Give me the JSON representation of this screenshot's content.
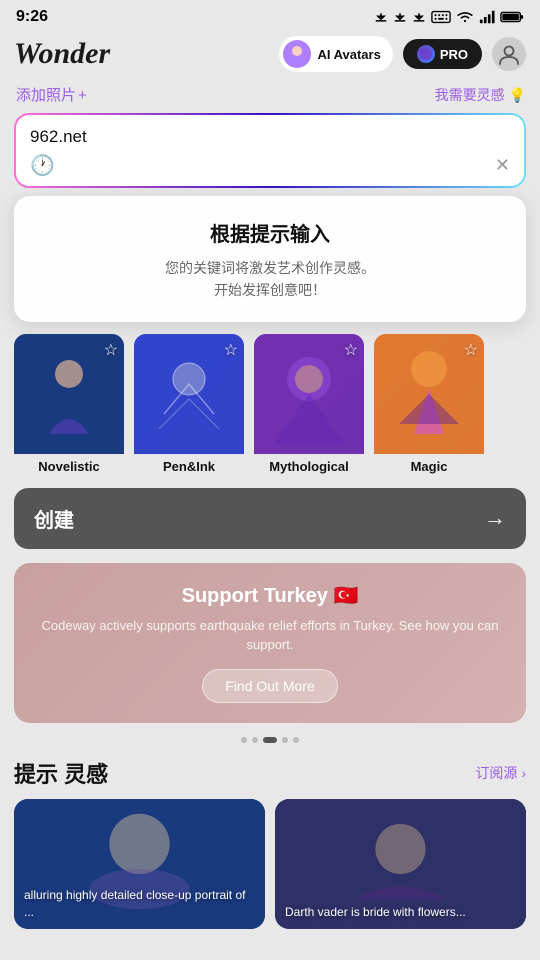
{
  "statusBar": {
    "time": "9:26"
  },
  "header": {
    "logo": "Wonder",
    "aiAvatarsLabel": "AI Avatars",
    "proLabel": "PRO"
  },
  "subtitle": {
    "addPhoto": "添加照片",
    "addPhotoIcon": "+",
    "needInspiration": "我需要灵感 💡"
  },
  "searchInput": {
    "value": "962.net",
    "placeholder": ""
  },
  "tooltipPopup": {
    "title": "根据提示输入",
    "description": "您的关键词将激发艺术创作灵感。\n开始发挥创意吧！"
  },
  "styleCards": [
    {
      "id": "novelistic",
      "label": "Novelistic",
      "cardClass": "card-novelistic"
    },
    {
      "id": "penink",
      "label": "Pen&Ink",
      "cardClass": "card-penink"
    },
    {
      "id": "mythological",
      "label": "Mythological",
      "cardClass": "card-mythological"
    },
    {
      "id": "magic",
      "label": "Magic",
      "cardClass": "card-magic"
    }
  ],
  "createButton": {
    "label": "创建",
    "arrow": "→"
  },
  "supportBanner": {
    "title": "Support Turkey 🇹🇷",
    "description": "Codeway actively supports earthquake relief efforts in Turkey. See how you can support.",
    "buttonLabel": "Find Out More"
  },
  "dots": [
    {
      "active": false
    },
    {
      "active": false
    },
    {
      "active": true
    },
    {
      "active": false
    },
    {
      "active": false
    }
  ],
  "inspirationSection": {
    "title": "提示 灵感",
    "subscribeLabel": "订阅源 ›",
    "cards": [
      {
        "text": "alluring highly detailed close-up portrait of ..."
      },
      {
        "text": "Darth vader is bride with flowers..."
      }
    ]
  }
}
